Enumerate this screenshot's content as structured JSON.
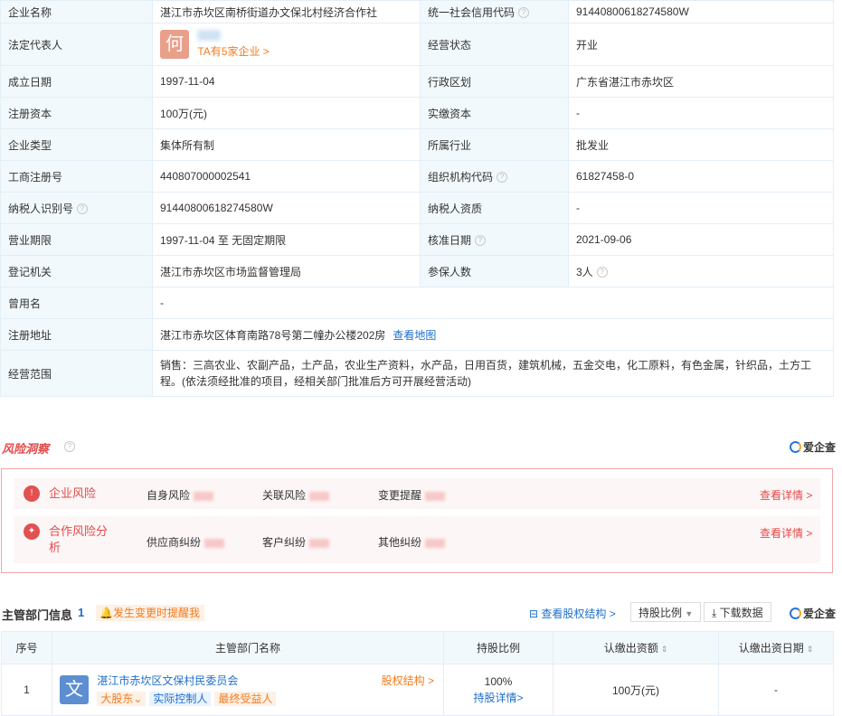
{
  "info": {
    "company_name_label": "企业名称",
    "company_name": "湛江市赤坎区南桥街道办文保北村经济合作社",
    "credit_code_label": "统一社会信用代码",
    "credit_code": "91440800618274580W",
    "legal_rep_label": "法定代表人",
    "legal_rep_avatar": "何",
    "legal_rep_companies": "TA有5家企业 >",
    "status_label": "经营状态",
    "status": "开业",
    "found_date_label": "成立日期",
    "found_date": "1997-11-04",
    "region_label": "行政区划",
    "region": "广东省湛江市赤坎区",
    "reg_capital_label": "注册资本",
    "reg_capital": "100万(元)",
    "paid_capital_label": "实缴资本",
    "paid_capital": "-",
    "type_label": "企业类型",
    "type": "集体所有制",
    "industry_label": "所属行业",
    "industry": "批发业",
    "reg_no_label": "工商注册号",
    "reg_no": "440807000002541",
    "org_code_label": "组织机构代码",
    "org_code": "61827458-0",
    "taxpayer_id_label": "纳税人识别号",
    "taxpayer_id": "91440800618274580W",
    "taxpayer_qual_label": "纳税人资质",
    "taxpayer_qual": "-",
    "term_label": "营业期限",
    "term": "1997-11-04 至 无固定期限",
    "approval_date_label": "核准日期",
    "approval_date": "2021-09-06",
    "authority_label": "登记机关",
    "authority": "湛江市赤坎区市场监督管理局",
    "insured_label": "参保人数",
    "insured": "3人",
    "former_name_label": "曾用名",
    "former_name": "-",
    "address_label": "注册地址",
    "address": "湛江市赤坎区体育南路78号第二幢办公楼202房",
    "view_map": "查看地图",
    "scope_label": "经营范围",
    "scope": "销售：三高农业、农副产品，土产品，农业生产资料，水产品，日用百货，建筑机械，五金交电，化工原料，有色金属，针织品，土方工程。(依法须经批准的项目，经相关部门批准后方可开展经营活动)"
  },
  "risk": {
    "title": "风险洞察",
    "brand": "爱企查",
    "rows": [
      {
        "name": "企业风险",
        "items": [
          "自身风险",
          "关联风险",
          "变更提醒"
        ],
        "more": "查看详情 >"
      },
      {
        "name": "合作风险分析",
        "items": [
          "供应商纠纷",
          "客户纠纷",
          "其他纠纷"
        ],
        "more": "查看详情 >"
      }
    ]
  },
  "supervisor": {
    "title": "主管部门信息",
    "count": "1",
    "remind": "发生变更时提醒我",
    "equity_link": "查看股权结构 >",
    "ratio_select": "持股比例",
    "download": "下载数据",
    "brand": "爱企查",
    "headers": [
      "序号",
      "主管部门名称",
      "持股比例",
      "认缴出资额",
      "认缴出资日期"
    ],
    "rows": [
      {
        "index": "1",
        "avatar": "文",
        "name": "湛江市赤坎区文保村民委员会",
        "equity": "股权结构 >",
        "tags": [
          "大股东",
          "实际控制人",
          "最终受益人"
        ],
        "ratio": "100%",
        "ratio_detail": "持股详情>",
        "amount": "100万(元)",
        "date": "-"
      }
    ]
  }
}
